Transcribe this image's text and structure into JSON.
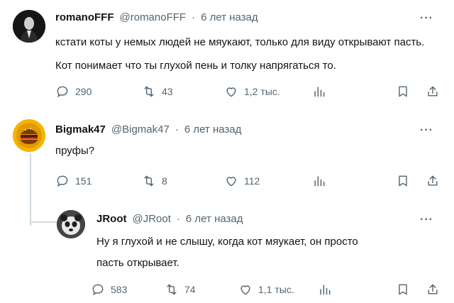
{
  "tweets": [
    {
      "name": "romanoFFF",
      "handle": "@romanoFFF",
      "dot": "·",
      "time": "6 лет назад",
      "lines": [
        "кстати коты у немых людей не мяукают, только для виду открывают пасть.",
        "Кот понимает что ты глухой пень и толку напрягаться то."
      ],
      "replies": "290",
      "retweets": "43",
      "likes": "1,2 тыс.",
      "more": "···"
    },
    {
      "name": "Bigmak47",
      "handle": "@Bigmak47",
      "dot": "·",
      "time": "6 лет назад",
      "lines": [
        "пруфы?"
      ],
      "replies": "151",
      "retweets": "8",
      "likes": "112",
      "more": "···"
    },
    {
      "name": "JRoot",
      "handle": "@JRoot",
      "dot": "·",
      "time": "6 лет назад",
      "lines": [
        "Ну я глухой и не слышу, когда кот мяукает, он просто",
        "пасть открывает."
      ],
      "replies": "583",
      "retweets": "74",
      "likes": "1,1 тыс.",
      "more": "···"
    }
  ],
  "colors": {
    "text": "#0f1419",
    "muted": "#536471",
    "line": "#cfd9de"
  },
  "icons": [
    "reply-icon",
    "retweet-icon",
    "like-icon",
    "views-icon",
    "bookmark-icon",
    "share-icon"
  ]
}
